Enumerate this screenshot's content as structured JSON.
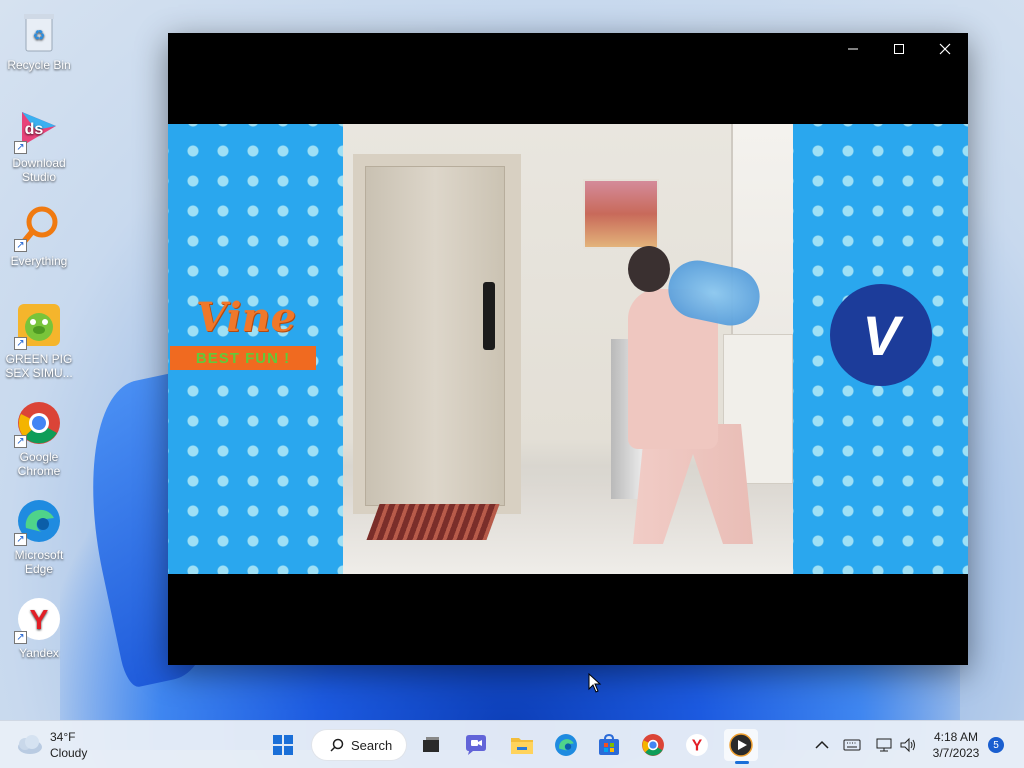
{
  "desktop": {
    "icons": [
      {
        "label": "Recycle Bin",
        "icon": "recycle-bin-icon"
      },
      {
        "label": "Download Studio",
        "icon": "download-studio-icon"
      },
      {
        "label": "Everything",
        "icon": "everything-search-icon"
      },
      {
        "label": "GREEN PIG SEX SIMU...",
        "icon": "green-pig-icon"
      },
      {
        "label": "Google Chrome",
        "icon": "chrome-icon"
      },
      {
        "label": "Microsoft Edge",
        "icon": "edge-icon"
      },
      {
        "label": "Yandex",
        "icon": "yandex-icon"
      }
    ]
  },
  "player": {
    "controls": {
      "minimize": "—",
      "maximize": "☐",
      "close": "✕"
    },
    "overlay": {
      "vine_text": "Vine",
      "banner_text": "BEST FUN !",
      "badge_text": "V"
    }
  },
  "taskbar": {
    "weather": {
      "temperature": "34°F",
      "condition": "Cloudy"
    },
    "search_label": "Search",
    "apps": [
      "start",
      "search",
      "task-view",
      "teams-chat",
      "file-explorer",
      "edge",
      "microsoft-store",
      "chrome",
      "yandex",
      "media-player"
    ],
    "clock": {
      "time": "4:18 AM",
      "date": "3/7/2023"
    },
    "notification_count": "5"
  },
  "colors": {
    "video_bg": "#2aa7ee",
    "accent": "#1a5fd0",
    "vine_orange": "#f0782a"
  }
}
